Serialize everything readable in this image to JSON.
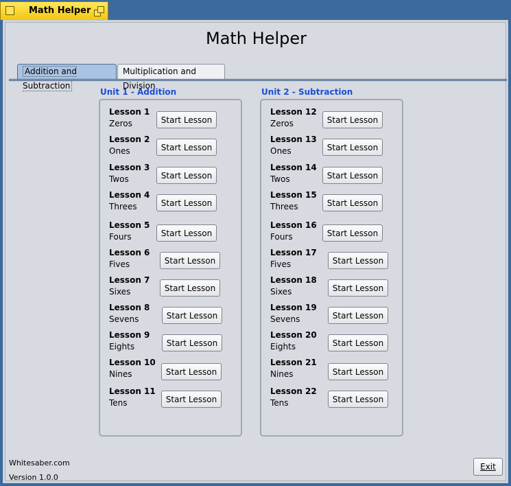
{
  "window": {
    "title": "Math Helper"
  },
  "app": {
    "heading": "Math Helper"
  },
  "tabs": [
    {
      "label": "Addition and Subtraction",
      "active": true
    },
    {
      "label": "Multiplication and Division",
      "active": false
    }
  ],
  "units": [
    {
      "heading": "Unit 1 - Addition",
      "lessons": [
        {
          "name": "Lesson 1",
          "topic": "Zeros",
          "button": "Start Lesson"
        },
        {
          "name": "Lesson 2",
          "topic": "Ones",
          "button": "Start Lesson"
        },
        {
          "name": "Lesson 3",
          "topic": "Twos",
          "button": "Start Lesson"
        },
        {
          "name": "Lesson 4",
          "topic": "Threes",
          "button": "Start Lesson"
        },
        {
          "name": "Lesson 5",
          "topic": "Fours",
          "button": "Start Lesson"
        },
        {
          "name": "Lesson 6",
          "topic": "Fives",
          "button": "Start Lesson"
        },
        {
          "name": "Lesson 7",
          "topic": "Sixes",
          "button": "Start Lesson"
        },
        {
          "name": "Lesson 8",
          "topic": "Sevens",
          "button": "Start Lesson"
        },
        {
          "name": "Lesson 9",
          "topic": "Eights",
          "button": "Start Lesson"
        },
        {
          "name": "Lesson 10",
          "topic": "Nines",
          "button": "Start Lesson"
        },
        {
          "name": "Lesson 11",
          "topic": "Tens",
          "button": "Start Lesson"
        }
      ]
    },
    {
      "heading": "Unit 2 - Subtraction",
      "lessons": [
        {
          "name": "Lesson 12",
          "topic": "Zeros",
          "button": "Start Lesson"
        },
        {
          "name": "Lesson 13",
          "topic": "Ones",
          "button": "Start Lesson"
        },
        {
          "name": "Lesson 14",
          "topic": "Twos",
          "button": "Start Lesson"
        },
        {
          "name": "Lesson 15",
          "topic": "Threes",
          "button": "Start Lesson"
        },
        {
          "name": "Lesson 16",
          "topic": "Fours",
          "button": "Start Lesson"
        },
        {
          "name": "Lesson 17",
          "topic": "Fives",
          "button": "Start Lesson"
        },
        {
          "name": "Lesson 18",
          "topic": "Sixes",
          "button": "Start Lesson"
        },
        {
          "name": "Lesson 19",
          "topic": "Sevens",
          "button": "Start Lesson"
        },
        {
          "name": "Lesson 20",
          "topic": "Eights",
          "button": "Start Lesson"
        },
        {
          "name": "Lesson 21",
          "topic": "Nines",
          "button": "Start Lesson"
        },
        {
          "name": "Lesson 22",
          "topic": "Tens",
          "button": "Start Lesson"
        }
      ]
    }
  ],
  "footer": {
    "website": "Whitesaber.com",
    "version": "Version 1.0.0",
    "exit_label": "Exit"
  },
  "colors": {
    "unit_heading": "#1a4fd6",
    "title_tab": "#f3c614",
    "desktop": "#3b6a9e"
  }
}
